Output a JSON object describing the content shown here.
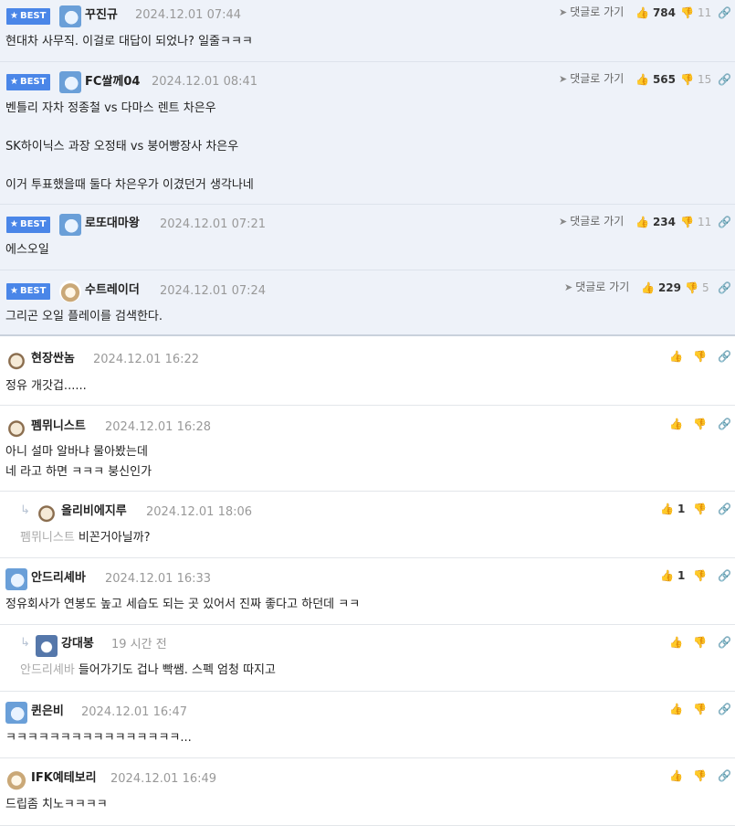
{
  "best_badge": "BEST",
  "reply_link": "댓글로 가기",
  "comments": [
    {
      "nick": "꾸진규",
      "date": "2024.12.01 07:44",
      "up": "784",
      "down": "11",
      "text": [
        "현대차 사무직. 이걸로 대답이 되었나? 일줄ㅋㅋㅋ"
      ],
      "avatar": "blue-icon"
    },
    {
      "nick": "FC쌀께04",
      "date": "2024.12.01 08:41",
      "up": "565",
      "down": "15",
      "text": [
        "벤틀리 자차 정종철 vs 다마스 렌트 차은우",
        "",
        "SK하이닉스 과장 오정태 vs 붕어빵장사 차은우",
        "",
        "이거 투표했을때 둘다 차은우가 이겼던거 생각나네"
      ],
      "avatar": "blue-icon"
    },
    {
      "nick": "로또대마왕",
      "date": "2024.12.01 07:21",
      "up": "234",
      "down": "11",
      "text": [
        "에스오일"
      ],
      "avatar": "blue-icon"
    },
    {
      "nick": "수트레이더",
      "date": "2024.12.01 07:24",
      "up": "229",
      "down": "5",
      "text": [
        "그리곤 오일 플레이를 검색한다."
      ],
      "avatar": "dog-icon"
    },
    {
      "nick": "현장싼놈",
      "date": "2024.12.01 16:22",
      "up": "",
      "text": [
        "정유 개갓겁......"
      ],
      "avatar": "puppy-icon"
    },
    {
      "nick": "펨뮈니스트",
      "date": "2024.12.01 16:28",
      "up": "",
      "text": [
        "아니 설마 알바냐 물아봤는데",
        "네 라고 하면 ㅋㅋㅋ 붕신인가"
      ],
      "avatar": "puppy-icon"
    },
    {
      "nick": "올리비에지루",
      "date": "2024.12.01 18:06",
      "up": "1",
      "ref": "펨뮈니스트",
      "text": [
        "비꼰거아닐까?"
      ],
      "avatar": "puppy-icon"
    },
    {
      "nick": "안드리셰바",
      "date": "2024.12.01 16:33",
      "up": "1",
      "text": [
        "정유회사가 연봉도 높고 세습도 되는 곳 있어서 진짜 좋다고 하던데 ㅋㅋ"
      ],
      "avatar": "blue-icon"
    },
    {
      "nick": "강대봉",
      "date": "19 시간 전",
      "up": "",
      "ref": "안드리셰바",
      "text": [
        "들어가기도 겁나 빡쌤. 스펙 엄청 따지고"
      ],
      "avatar": "blue-icon"
    },
    {
      "nick": "퀸은비",
      "date": "2024.12.01 16:47",
      "up": "",
      "text": [
        "ㅋㅋㅋㅋㅋㅋㅋㅋㅋㅋㅋㅋㅋㅋㅋㅋ..."
      ],
      "avatar": "blue-icon"
    },
    {
      "nick": "IFK예테보리",
      "date": "2024.12.01 16:49",
      "up": "",
      "text": [
        "드립좀 치노ㅋㅋㅋㅋ"
      ],
      "avatar": "dog-icon"
    }
  ]
}
